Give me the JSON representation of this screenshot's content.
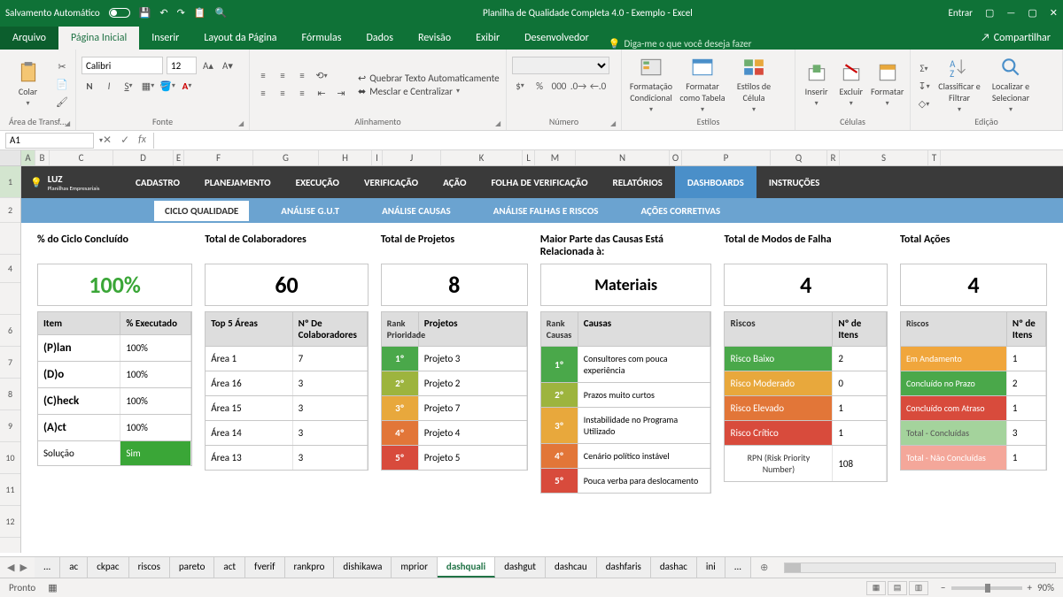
{
  "titlebar": {
    "autosave": "Salvamento Automático",
    "title": "Planilha de Qualidade Completa 4.0 - Exemplo  -  Excel",
    "signin": "Entrar"
  },
  "tabs": {
    "file": "Arquivo",
    "home": "Página Inicial",
    "insert": "Inserir",
    "layout": "Layout da Página",
    "formulas": "Fórmulas",
    "data": "Dados",
    "review": "Revisão",
    "view": "Exibir",
    "developer": "Desenvolvedor",
    "tellme": "Diga-me o que você deseja fazer",
    "share": "Compartilhar"
  },
  "ribbon": {
    "clipboard": "Área de Transf...",
    "paste": "Colar",
    "font_group": "Fonte",
    "font_name": "Calibri",
    "font_size": "12",
    "align_group": "Alinhamento",
    "wrap": "Quebrar Texto Automaticamente",
    "merge": "Mesclar e Centralizar",
    "number_group": "Número",
    "styles_group": "Estilos",
    "cond": "Formatação Condicional",
    "table": "Formatar como Tabela",
    "cellstyle": "Estilos de Célula",
    "cells_group": "Células",
    "insert_btn": "Inserir",
    "delete_btn": "Excluir",
    "format_btn": "Formatar",
    "edit_group": "Edição",
    "sort": "Classificar e Filtrar",
    "find": "Localizar e Selecionar"
  },
  "formula": {
    "cell": "A1"
  },
  "columns": [
    "A",
    "B",
    "C",
    "D",
    "E",
    "F",
    "G",
    "H",
    "I",
    "J",
    "K",
    "L",
    "M",
    "N",
    "O",
    "P",
    "Q",
    "R",
    "S",
    "T"
  ],
  "rows": [
    "1",
    "2",
    "",
    "4",
    "",
    "6",
    "7",
    "8",
    "9",
    "10",
    "11",
    "12"
  ],
  "nav": {
    "logo": "LUZ",
    "logo_sub": "Planilhas Empresariais",
    "items": [
      "CADASTRO",
      "PLANEJAMENTO",
      "EXECUÇÃO",
      "VERIFICAÇÃO",
      "AÇÃO",
      "FOLHA DE VERIFICAÇÃO",
      "RELATÓRIOS",
      "DASHBOARDS",
      "INSTRUÇÕES"
    ],
    "active": 7,
    "sub": [
      "CICLO QUALIDADE",
      "ANÁLISE G.U.T",
      "ANÁLISE CAUSAS",
      "ANÁLISE FALHAS E RISCOS",
      "AÇÕES CORRETIVAS"
    ],
    "sub_active": 0
  },
  "cards": {
    "c1": {
      "title": "% do Ciclo Concluído",
      "big": "100%",
      "head": [
        "Item",
        "% Executado"
      ],
      "rows": [
        [
          "(P)lan",
          "100%"
        ],
        [
          "(D)o",
          "100%"
        ],
        [
          "(C)heck",
          "100%"
        ],
        [
          "(A)ct",
          "100%"
        ],
        [
          "Solução",
          "Sim"
        ]
      ]
    },
    "c2": {
      "title": "Total de Colaboradores",
      "big": "60",
      "head": [
        "Top 5 Áreas",
        "Nº De Colaboradores"
      ],
      "rows": [
        [
          "Área 1",
          "7"
        ],
        [
          "Área 16",
          "3"
        ],
        [
          "Área 15",
          "3"
        ],
        [
          "Área 14",
          "3"
        ],
        [
          "Área 13",
          "3"
        ]
      ]
    },
    "c3": {
      "title": "Total de Projetos",
      "big": "8",
      "head": [
        "Rank Prioridade",
        "Projetos"
      ],
      "rows": [
        [
          "1º",
          "Projeto 3"
        ],
        [
          "2º",
          "Projeto 2"
        ],
        [
          "3º",
          "Projeto 7"
        ],
        [
          "4º",
          "Projeto 4"
        ],
        [
          "5º",
          "Projeto 5"
        ]
      ]
    },
    "c4": {
      "title": "Maior Parte das Causas Está Relacionada à:",
      "big": "Materiais",
      "head": [
        "Rank Causas",
        "Causas"
      ],
      "rows": [
        [
          "1º",
          "Consultores com pouca experiência"
        ],
        [
          "2º",
          "Prazos muito curtos"
        ],
        [
          "3º",
          "Instabilidade no Programa Utilizado"
        ],
        [
          "4º",
          "Cenário político instável"
        ],
        [
          "5º",
          "Pouca verba para deslocamento"
        ]
      ]
    },
    "c5": {
      "title": "Total de Modos de Falha",
      "big": "4",
      "head": [
        "Riscos",
        "Nº de Itens"
      ],
      "rows": [
        [
          "Risco Baixo",
          "2"
        ],
        [
          "Risco Moderado",
          "0"
        ],
        [
          "Risco Elevado",
          "1"
        ],
        [
          "Risco Crítico",
          "1"
        ],
        [
          "RPN (Risk Priority Number)",
          "108"
        ]
      ]
    },
    "c6": {
      "title": "Total Ações",
      "big": "4",
      "head": [
        "Riscos",
        "Nº de Itens"
      ],
      "rows": [
        [
          "Em Andamento",
          "1"
        ],
        [
          "Concluído no Prazo",
          "2"
        ],
        [
          "Concluído com Atraso",
          "1"
        ],
        [
          "Total - Concluídas",
          "3"
        ],
        [
          "Total - Não Concluídas",
          "1"
        ]
      ]
    }
  },
  "sheet_tabs": [
    "...",
    "ac",
    "ckpac",
    "riscos",
    "pareto",
    "act",
    "fverif",
    "rankpro",
    "dishikawa",
    "mprior",
    "dashquali",
    "dashgut",
    "dashcau",
    "dashfaris",
    "dashac",
    "ini",
    "..."
  ],
  "sheet_active": "dashquali",
  "status": {
    "ready": "Pronto",
    "zoom": "90%"
  }
}
